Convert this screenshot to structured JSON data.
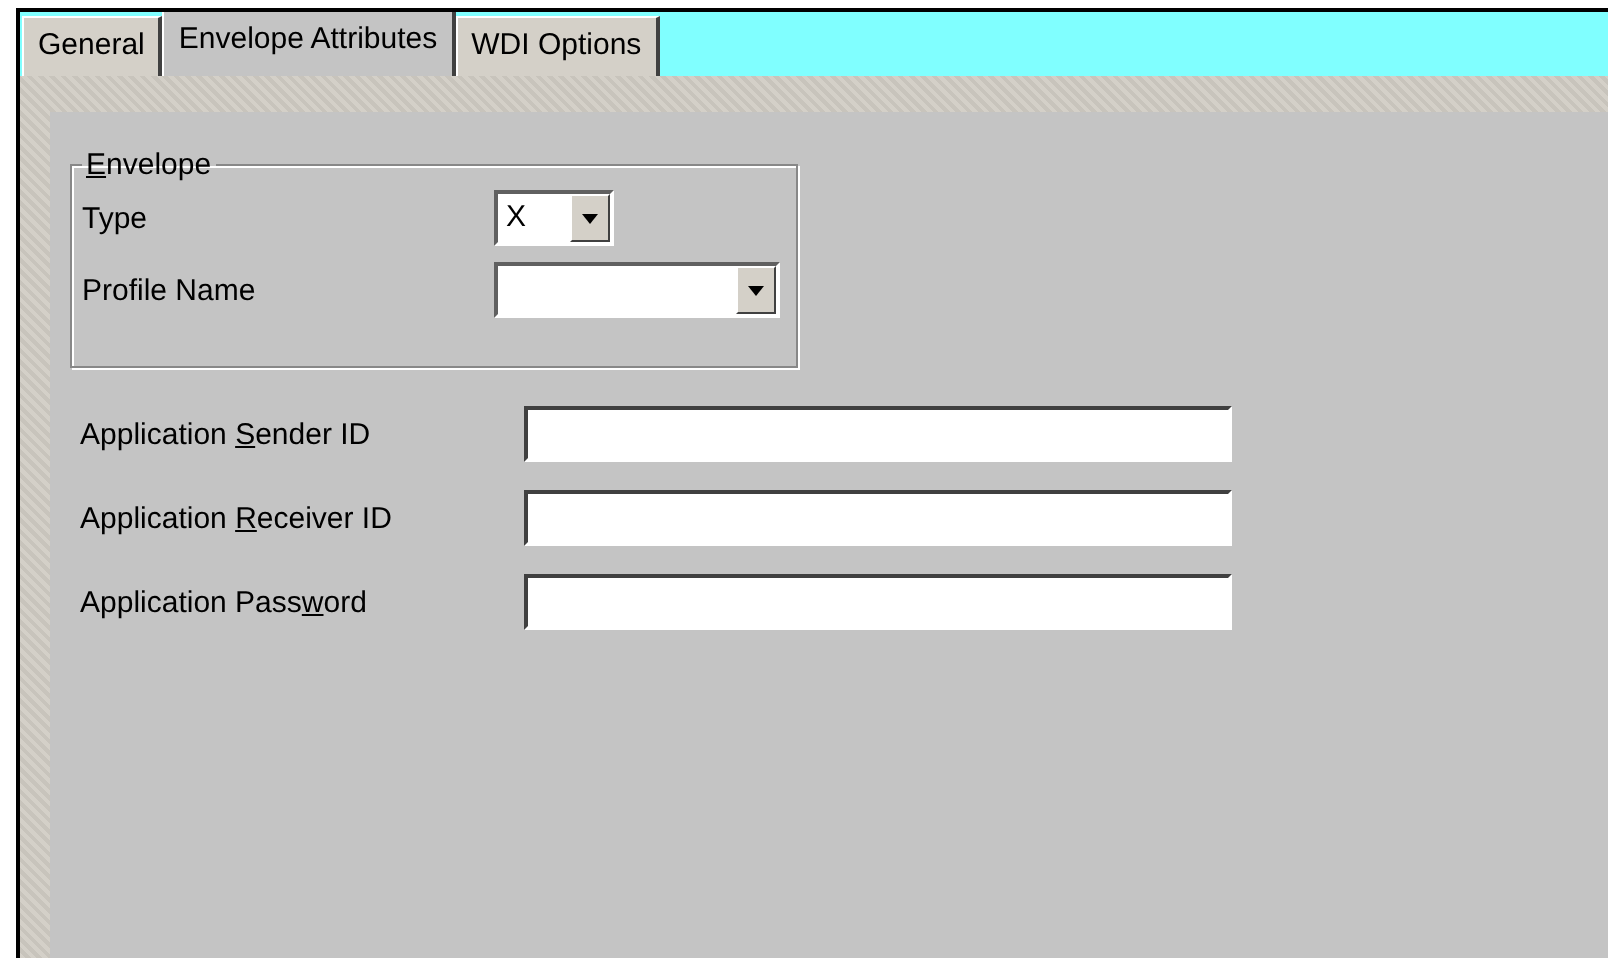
{
  "tabs": [
    {
      "label": "General",
      "selected": false
    },
    {
      "label": "Envelope Attributes",
      "selected": true
    },
    {
      "label": "WDI Options",
      "selected": false
    }
  ],
  "envelope": {
    "legend": {
      "key": "E",
      "post": "nvelope"
    },
    "combos": [
      {
        "label": "Type",
        "value": "X",
        "kind": "narrow"
      },
      {
        "label": "Profile Name",
        "kind": "wide"
      }
    ]
  },
  "fields": [
    {
      "label": {
        "pre": "Application ",
        "key": "S",
        "post": "ender ID"
      }
    },
    {
      "label": {
        "pre": "Application ",
        "key": "R",
        "post": "eceiver ID"
      }
    },
    {
      "label": {
        "pre": "Application Pass",
        "key": "w",
        "post": "ord"
      }
    }
  ]
}
